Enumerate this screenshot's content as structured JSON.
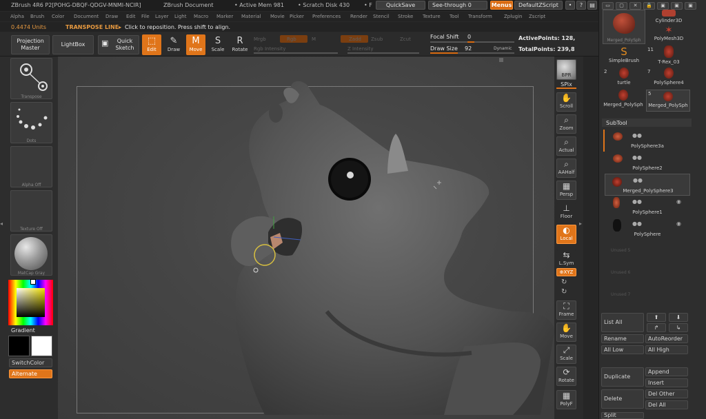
{
  "title_bar": {
    "app": "ZBrush 4R6 P2[POHG-DBQF-QDGV-MNMI-NCIR]",
    "document": "ZBrush Document",
    "active_mem": "• Active Mem 981",
    "scratch_disk": "• Scratch Disk 430",
    "fr": "• F",
    "quicksave": "QuickSave",
    "see_through": "See-through  0",
    "menus": "Menus",
    "default_zscript": "DefaultZScript"
  },
  "menu_bar": [
    "Alpha",
    "Brush",
    "Color",
    "Document",
    "Draw",
    "Edit",
    "File",
    "Layer",
    "Light",
    "Macro",
    "Marker",
    "Material",
    "Movie",
    "Picker",
    "Preferences",
    "Render",
    "Stencil",
    "Stroke",
    "Texture",
    "Tool",
    "Transform",
    "Zplugin",
    "Zscript"
  ],
  "info_bar": {
    "units": "0.4474 Units",
    "mode": "TRANSPOSE LINE▸",
    "hint": "Click to reposition. Press shift to align."
  },
  "toolbar": {
    "projection_master": [
      "Projection",
      "Master"
    ],
    "lightbox": "LightBox",
    "quick_sketch": [
      "Quick",
      "Sketch"
    ],
    "edit": "Edit",
    "draw": "Draw",
    "move": "Move",
    "scale": "Scale",
    "rotate": "Rotate",
    "mrgb": "Mrgb",
    "rgb": "Rgb",
    "m": "M",
    "zadd": "Zadd",
    "zsub": "Zsub",
    "zcut": "Zcut",
    "rgb_intensity": "Rgb Intensity",
    "z_intensity": "Z Intensity",
    "focal_shift_label": "Focal Shift",
    "focal_shift_value": "0",
    "draw_size_label": "Draw Size",
    "draw_size_value": "92",
    "dynamic": "Dynamic",
    "active_points": "ActivePoints: 128,",
    "total_points": "TotalPoints: 239,8"
  },
  "left_shelf": {
    "transpose": "Transpose",
    "dots": "Dots",
    "alpha_off": "Alpha Off",
    "texture_off": "Texture Off",
    "matcap": "MatCap Gray",
    "gradient": "Gradient",
    "switch_color": "SwitchColor",
    "alternate": "Alternate"
  },
  "right_shelf": {
    "bpr": "BPR",
    "spix": "SPix",
    "scroll": "Scroll",
    "zoom": "Zoom",
    "actual": "Actual",
    "aahalf": "AAHalf",
    "persp": "Persp",
    "floor": "Floor",
    "local": "Local",
    "lsym": "L.Sym",
    "xyz": "⊕XYZ",
    "frame": "Frame",
    "move": "Move",
    "scale": "Scale",
    "rotate": "Rotate",
    "polyf": "PolyF"
  },
  "tool_palette": {
    "items": [
      {
        "label": "Merged_PolySph",
        "num": ""
      },
      {
        "label": "Cylinder3D",
        "num": ""
      },
      {
        "label": "PolyMesh3D",
        "num": ""
      },
      {
        "label": "SimpleBrush",
        "num": ""
      },
      {
        "label": "T-Rex_03",
        "num": "11"
      },
      {
        "label": "turtle",
        "num": "2"
      },
      {
        "label": "PolySphere4",
        "num": "7"
      },
      {
        "label": "Merged_PolySph",
        "num": ""
      },
      {
        "label": "Merged_PolySph",
        "num": "5"
      }
    ]
  },
  "subtool": {
    "header": "SubTool",
    "items": [
      "PolySphere3a",
      "PolySphere2",
      "Merged_PolySphere3",
      "PolySphere1",
      "PolySphere"
    ],
    "empty_slots": [
      "Unused 5",
      "Unused 6",
      "Unused 7"
    ],
    "list_all": "List All",
    "rename": "Rename",
    "auto_reorder": "AutoReorder",
    "all_low": "All Low",
    "all_high": "All High",
    "duplicate": "Duplicate",
    "append": "Append",
    "insert": "Insert",
    "delete": "Delete",
    "del_other": "Del Other",
    "del_all": "Del All",
    "split": "Split"
  },
  "colors": {
    "accent": "#e0751a",
    "background": "#2a2a2a",
    "model": "#5a5a5a"
  }
}
